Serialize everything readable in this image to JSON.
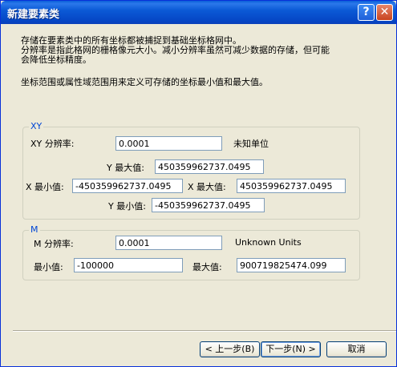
{
  "window": {
    "title": "新建要素类"
  },
  "titlebar": {
    "help_glyph": "?",
    "close_glyph": "✕"
  },
  "description": {
    "line1": "存储在要素类中的所有坐标都被捕捉到基础坐标格网中。",
    "line2": "分辨率是指此格网的栅格像元大小。减小分辨率虽然可减少数据的存储，但可能",
    "line3": "会降低坐标精度。",
    "line4": "坐标范围或属性域范围用来定义可存储的坐标最小值和最大值。"
  },
  "xy_group": {
    "legend": "XY",
    "resolution_label": "XY 分辨率:",
    "resolution_value": "0.0001",
    "units_label": "未知单位",
    "y_max_label": "Y 最大值:",
    "y_max_value": "450359962737.0495",
    "x_min_label": "X 最小值:",
    "x_min_value": "-450359962737.0495",
    "x_max_label": "X 最大值:",
    "x_max_value": "450359962737.0495",
    "y_min_label": "Y 最小值:",
    "y_min_value": "-450359962737.0495"
  },
  "m_group": {
    "legend": "M",
    "resolution_label": "M 分辨率:",
    "resolution_value": "0.0001",
    "units_label": "Unknown Units",
    "min_label": "最小值:",
    "min_value": "-100000",
    "max_label": "最大值:",
    "max_value": "900719825474.099"
  },
  "buttons": {
    "back": "< 上一步(B)",
    "next": "下一步(N) >",
    "cancel": "取消"
  }
}
